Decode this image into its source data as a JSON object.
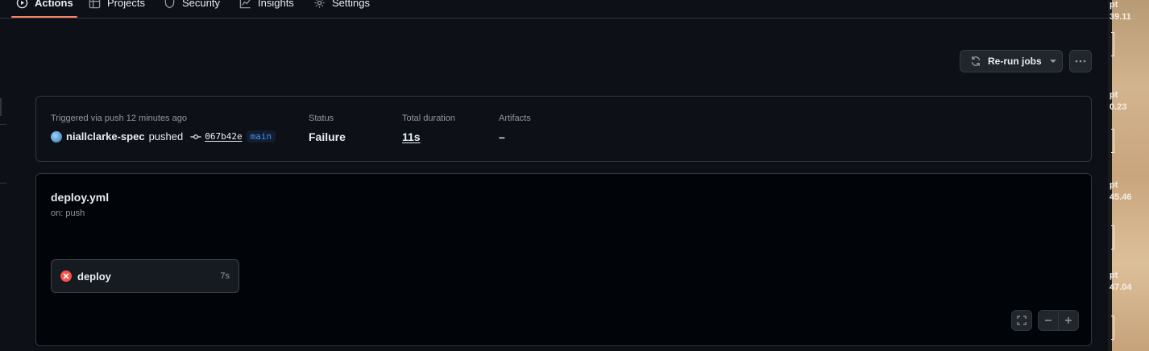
{
  "nav": {
    "tabs": [
      {
        "label": "Actions",
        "active": true
      },
      {
        "label": "Projects"
      },
      {
        "label": "Security"
      },
      {
        "label": "Insights"
      },
      {
        "label": "Settings"
      }
    ]
  },
  "header": {
    "rerun_label": "Re-run jobs"
  },
  "summary": {
    "trigger_text": "Triggered via push 12 minutes ago",
    "actor": "niallclarke-spec",
    "action": "pushed",
    "commit_sha": "067b42e",
    "branch": "main",
    "status_label": "Status",
    "status_value": "Failure",
    "duration_label": "Total duration",
    "duration_value": "11s",
    "artifacts_label": "Artifacts",
    "artifacts_value": "–"
  },
  "workflow": {
    "file": "deploy.yml",
    "trigger": "on: push",
    "jobs": [
      {
        "name": "deploy",
        "duration": "7s",
        "status": "failure"
      }
    ]
  },
  "desktop": {
    "labels": [
      "pt",
      "39.11",
      "pt",
      "0.23",
      "pt",
      "45.46",
      "pt",
      "47.04"
    ]
  },
  "colors": {
    "accent_underline": "#f78166",
    "failure": "#f85149",
    "branch": "#4493f8"
  }
}
